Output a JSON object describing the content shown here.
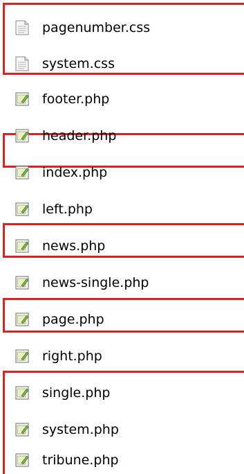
{
  "files": [
    {
      "name": "pagenumber.css",
      "icon": "css-document-icon",
      "highlighted": true
    },
    {
      "name": "system.css",
      "icon": "css-document-icon",
      "highlighted": true
    },
    {
      "name": "footer.php",
      "icon": "php-script-icon",
      "highlighted": false
    },
    {
      "name": "header.php",
      "icon": "php-script-icon",
      "highlighted": false
    },
    {
      "name": "index.php",
      "icon": "php-script-icon",
      "highlighted": true
    },
    {
      "name": "left.php",
      "icon": "php-script-icon",
      "highlighted": false
    },
    {
      "name": "news.php",
      "icon": "php-script-icon",
      "highlighted": true
    },
    {
      "name": "news-single.php",
      "icon": "php-script-icon",
      "highlighted": false
    },
    {
      "name": "page.php",
      "icon": "php-script-icon",
      "highlighted": true
    },
    {
      "name": "right.php",
      "icon": "php-script-icon",
      "highlighted": false
    },
    {
      "name": "single.php",
      "icon": "php-script-icon",
      "highlighted": true
    },
    {
      "name": "system.php",
      "icon": "php-script-icon",
      "highlighted": true
    },
    {
      "name": "tribune.php",
      "icon": "php-script-icon",
      "highlighted": true
    }
  ],
  "colors": {
    "highlight_border": "#e02020",
    "php_icon_accent": "#7ab648",
    "text": "#000000"
  }
}
